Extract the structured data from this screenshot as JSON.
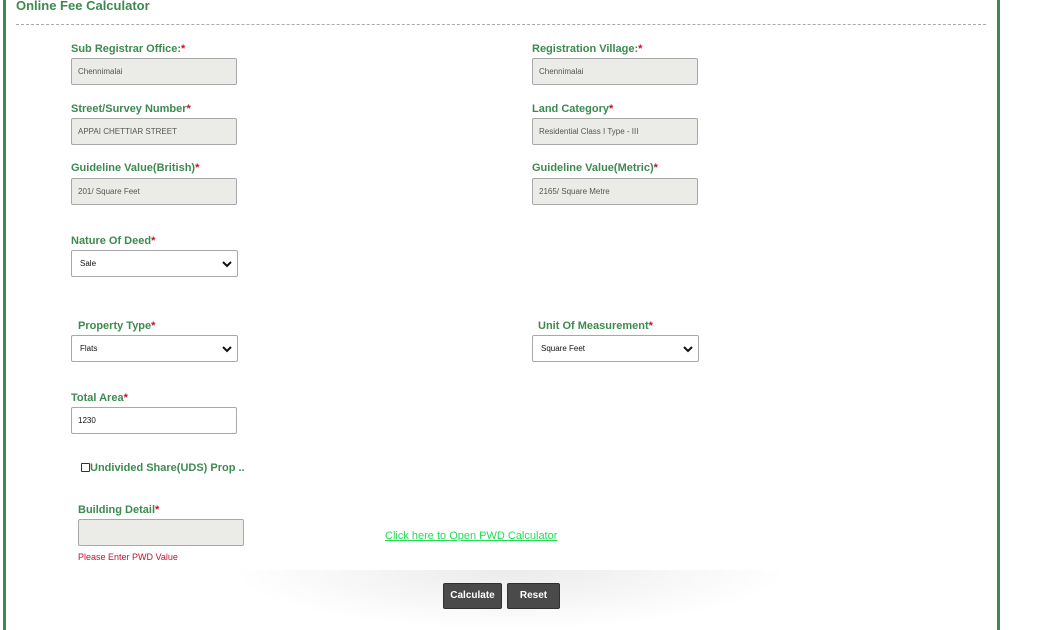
{
  "header": {
    "title": "Online Fee Calculator"
  },
  "form": {
    "sub_registrar_office": {
      "label": "Sub Registrar Office:",
      "required": "*",
      "value": "Chennimalai"
    },
    "registration_village": {
      "label": "Registration Village:",
      "required": "*",
      "value": "Chennimalai"
    },
    "street_survey_number": {
      "label": "Street/Survey Number",
      "required": "*",
      "value": "APPAI CHETTIAR STREET"
    },
    "land_category": {
      "label": "Land Category",
      "required": "*",
      "value": "Residential Class I Type - III"
    },
    "guideline_british": {
      "label": "Guideline Value(British)",
      "required": "*",
      "value": "201/ Square Feet"
    },
    "guideline_metric": {
      "label": "Guideline Value(Metric)",
      "required": "*",
      "value": "2165/ Square Metre"
    },
    "nature_of_deed": {
      "label": "Nature Of Deed",
      "required": "*",
      "selected": "Sale"
    },
    "property_type": {
      "label": "Property Type",
      "required": "*",
      "selected": "Flats"
    },
    "unit_of_measurement": {
      "label": "Unit Of Measurement",
      "required": "*",
      "selected": "Square Feet"
    },
    "total_area": {
      "label": "Total Area",
      "required": "*",
      "value": "1230"
    },
    "uds_checkbox": {
      "label": "Undivided Share(UDS) Prop ..",
      "checked": false
    },
    "building_detail": {
      "label": "Building Detail",
      "required": "*",
      "value": "",
      "error": "Please Enter PWD Value"
    },
    "pwd_link": {
      "label": "Click here to Open PWD Calculator"
    }
  },
  "actions": {
    "calculate_label": "Calculate",
    "reset_label": "Reset"
  },
  "colors": {
    "accent": "#3d8a50",
    "required": "#c8102e",
    "link": "#22dd55",
    "button": "#4a4a4a"
  }
}
